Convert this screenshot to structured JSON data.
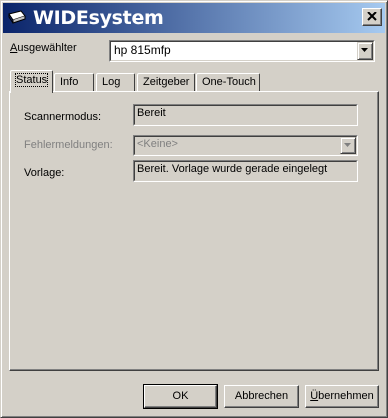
{
  "window": {
    "title": "WIDEsystem",
    "close_label": "✕"
  },
  "selector": {
    "label_prefix": "A",
    "label_rest": "usgewählter",
    "value": "hp 815mfp"
  },
  "tabs": [
    {
      "label": "Status",
      "active": true
    },
    {
      "label": "Info"
    },
    {
      "label": "Log"
    },
    {
      "label": "Zeitgeber"
    },
    {
      "label": "One-Touch"
    }
  ],
  "status": {
    "scanner_mode_label": "Scannermodus:",
    "scanner_mode_value": "Bereit",
    "errors_label": "Fehlermeldungen:",
    "errors_value": "<Keine>",
    "template_label": "Vorlage:",
    "template_value": "Bereit. Vorlage wurde gerade eingelegt"
  },
  "buttons": {
    "ok": "OK",
    "cancel": "Abbrechen",
    "apply_first": "Ü",
    "apply_rest": "bernehmen"
  },
  "colors": {
    "face": "#d4d0c8",
    "title_start": "#0a246a",
    "title_end": "#a6caf0"
  }
}
